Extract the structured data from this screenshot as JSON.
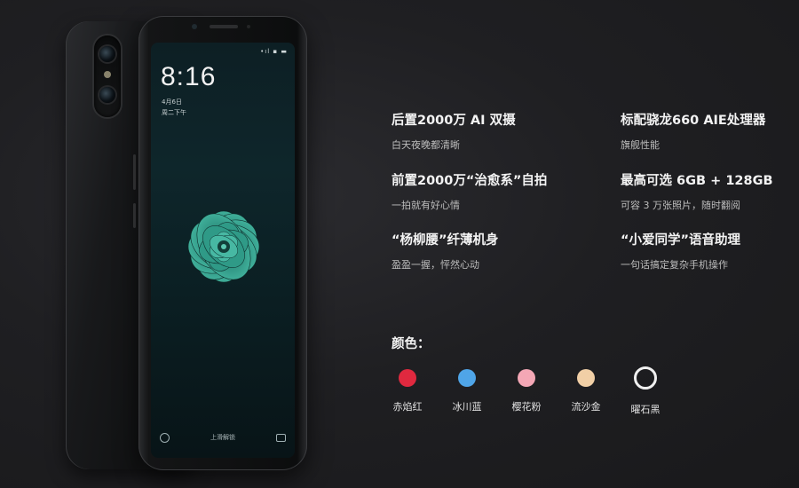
{
  "phone": {
    "clock_time": "8:16",
    "clock_date": "4月6日",
    "clock_day": "周二下午",
    "lock_hint": "上滑解锁",
    "status_icons": "•ıl ▪ ▬",
    "screen_accent": "#2e8f80"
  },
  "features": [
    {
      "title": "后置2000万 AI 双摄",
      "subtitle": "白天夜晚都清晰"
    },
    {
      "title": "标配骁龙660 AIE处理器",
      "subtitle": "旗舰性能"
    },
    {
      "title": "前置2000万“治愈系”自拍",
      "subtitle": "一拍就有好心情"
    },
    {
      "title": "最高可选 6GB + 128GB",
      "subtitle": "可容 3 万张照片，随时翻阅"
    },
    {
      "title": "“杨柳腰”纤薄机身",
      "subtitle": "盈盈一握，怦然心动"
    },
    {
      "title": "“小爱同学”语音助理",
      "subtitle": "一句话搞定复杂手机操作"
    }
  ],
  "colors": {
    "heading": "颜色：",
    "options": [
      {
        "label": "赤焰红",
        "hex": "#e0293f"
      },
      {
        "label": "冰川蓝",
        "hex": "#4fa5e8"
      },
      {
        "label": "樱花粉",
        "hex": "#f4a7b5"
      },
      {
        "label": "流沙金",
        "hex": "#f1cfa6"
      },
      {
        "label": "曜石黑",
        "hex": "#1f1f22"
      }
    ]
  }
}
